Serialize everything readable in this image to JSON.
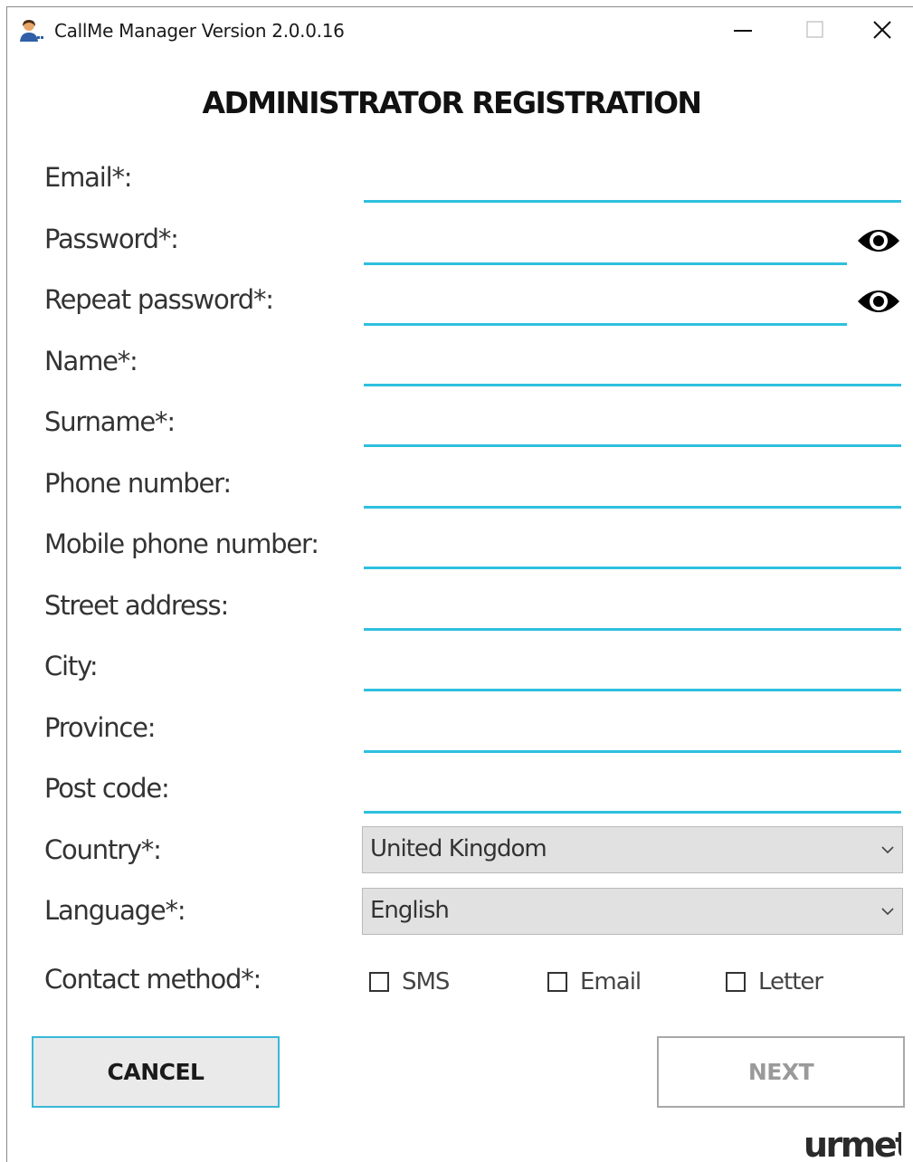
{
  "window": {
    "title": "CallMe Manager Version  2.0.0.16"
  },
  "heading": "ADMINISTRATOR REGISTRATION",
  "form": {
    "email_label": "Email*:",
    "password_label": "Password*:",
    "repeat_password_label": "Repeat password*:",
    "name_label": "Name*:",
    "surname_label": "Surname*:",
    "phone_label": "Phone number:",
    "mobile_label": "Mobile phone number:",
    "street_label": "Street address:",
    "city_label": "City:",
    "province_label": "Province:",
    "postcode_label": "Post code:",
    "country_label": "Country*:",
    "country_value": "United Kingdom",
    "language_label": "Language*:",
    "language_value": "English",
    "contact_label": "Contact method*:",
    "contact_options": [
      "SMS",
      "Email",
      "Letter"
    ]
  },
  "buttons": {
    "cancel": "CANCEL",
    "next": "NEXT"
  },
  "logo": "urmet",
  "colors": {
    "accent_underline": "#2ec0de",
    "cancel_border": "#3ab8d8",
    "next_text_disabled": "#9a9a9a"
  },
  "icons": {
    "app": "user-icon",
    "minimize": "minimize-icon",
    "maximize": "maximize-icon",
    "close": "close-icon",
    "password_toggle": "eye-icon",
    "dropdown": "chevron-down-icon"
  }
}
